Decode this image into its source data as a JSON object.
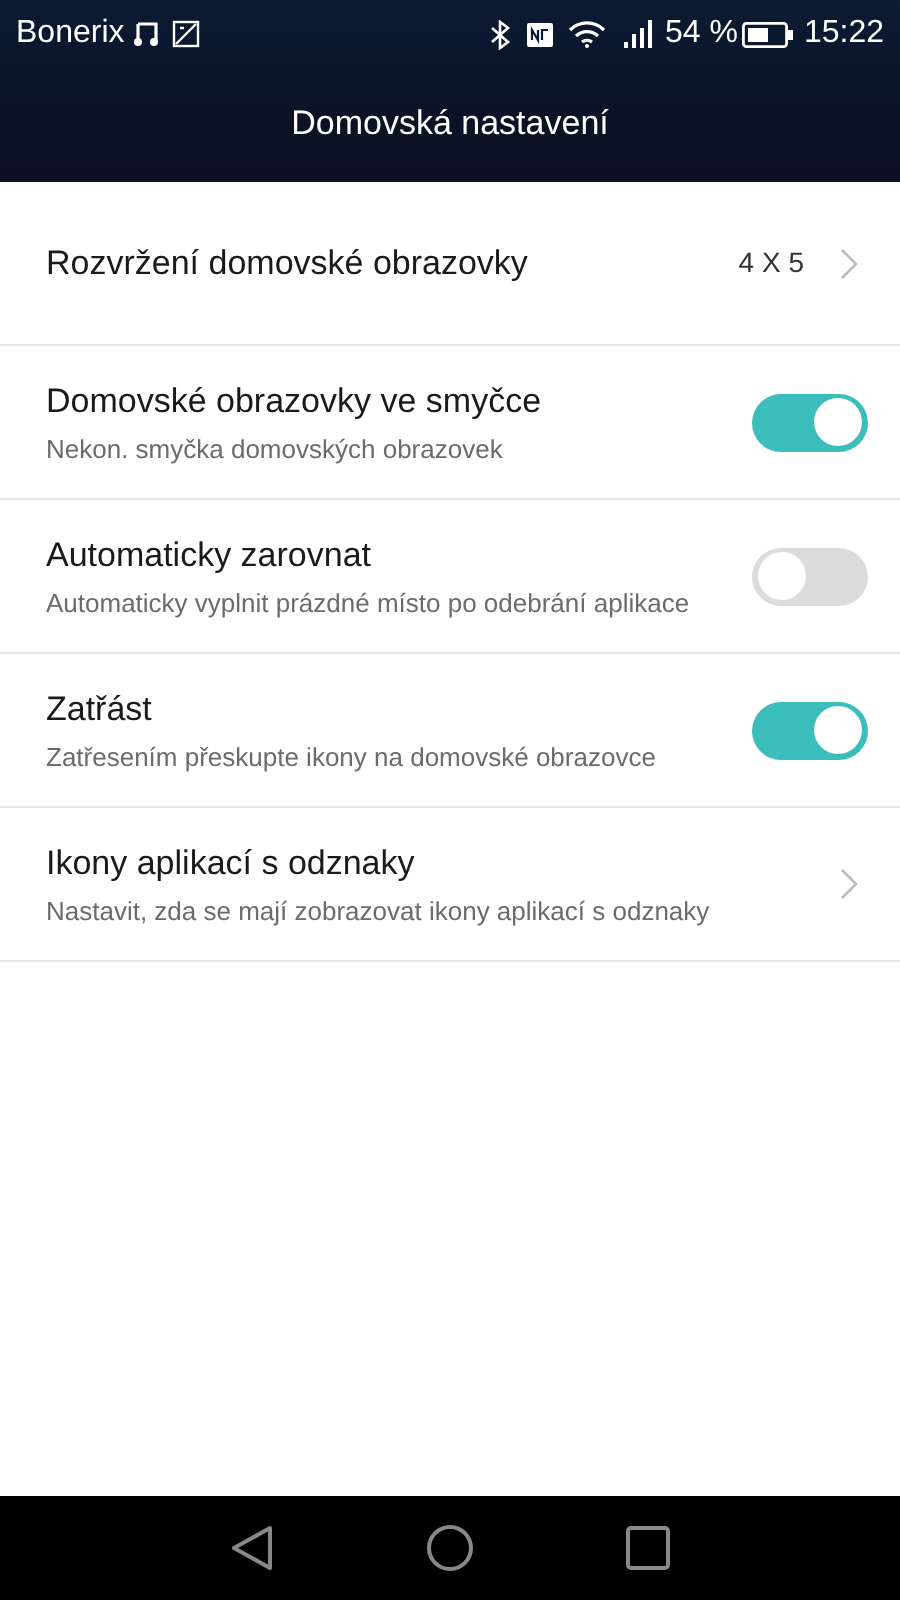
{
  "status_bar": {
    "carrier": "Bonerix",
    "battery_text": "54 %",
    "time": "15:22"
  },
  "title": "Domovská nastavení",
  "settings": [
    {
      "kind": "link",
      "title": "Rozvržení domovské obrazovky",
      "value": "4 X 5"
    },
    {
      "kind": "toggle",
      "title": "Domovské obrazovky ve smyčce",
      "subtitle": "Nekon. smyčka domovských obrazovek",
      "on": true
    },
    {
      "kind": "toggle",
      "title": "Automaticky zarovnat",
      "subtitle": "Automaticky vyplnit prázdné místo po odebrání aplikace",
      "on": false
    },
    {
      "kind": "toggle",
      "title": "Zatřást",
      "subtitle": "Zatřesením přeskupte ikony na domovské obrazovce",
      "on": true
    },
    {
      "kind": "link",
      "title": "Ikony aplikací s odznaky",
      "subtitle": "Nastavit, zda se mají zobrazovat ikony aplikací s odznaky"
    }
  ]
}
